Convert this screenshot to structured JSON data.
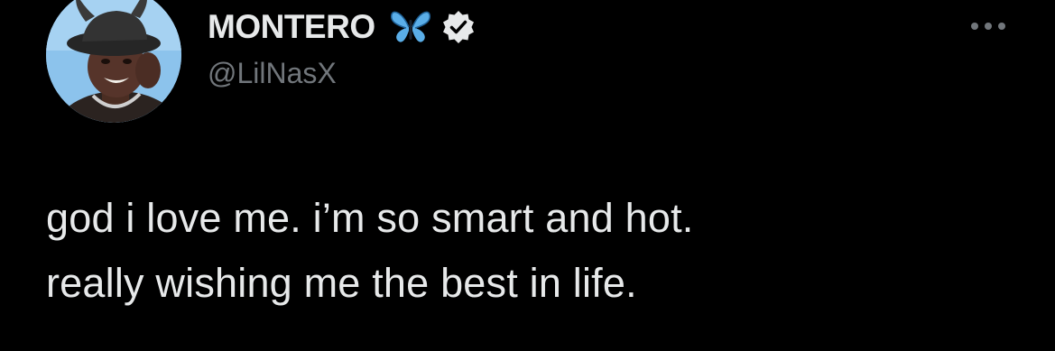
{
  "tweet": {
    "author": {
      "display_name": "MONTERO",
      "name_emoji": "butterfly-emoji",
      "verified_badge": "verified-check-icon",
      "handle": "@LilNasX"
    },
    "more_options_icon": "more-dots-icon",
    "text_lines": [
      "god i love me. i’m so smart and hot.",
      "really wishing me the best in life."
    ]
  },
  "colors": {
    "background": "#000000",
    "primary_text": "#e7e9ea",
    "secondary_text": "#71767b",
    "butterfly": "#5aaee8",
    "avatar_sky": "#8cc3ec"
  }
}
